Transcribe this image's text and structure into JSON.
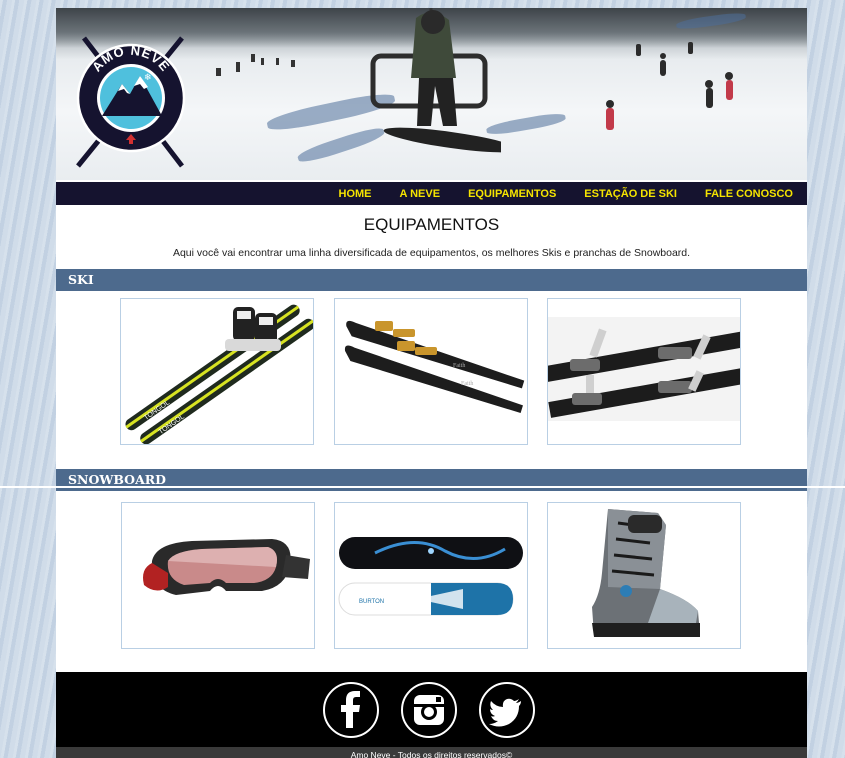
{
  "logo": {
    "text": "AMO NEVE"
  },
  "nav": {
    "items": [
      "HOME",
      "A NEVE",
      "EQUIPAMENTOS",
      "ESTAÇÃO DE SKI",
      "FALE CONOSCO"
    ]
  },
  "main": {
    "title": "EQUIPAMENTOS",
    "intro": "Aqui você vai encontrar uma linha diversificada de equipamentos, os melhores Skis e pranchas de Snowboard."
  },
  "sections": [
    {
      "label": "SKI",
      "items": [
        "ski-pair-yellow-icon",
        "ski-pair-black-icon",
        "ski-bindings-icon"
      ]
    },
    {
      "label": "SNOWBOARD",
      "items": [
        "goggles-icon",
        "snowboards-icon",
        "snowboard-boot-icon"
      ]
    }
  ],
  "footer": {
    "social": [
      "facebook-icon",
      "instagram-icon",
      "twitter-icon"
    ],
    "copyright": "Amo Neve - Todos os direitos reservados©"
  },
  "colors": {
    "nav_bg": "#15132f",
    "nav_text": "#f5e400",
    "section_bar": "#4d6a8d",
    "footer_bg": "#000000"
  }
}
